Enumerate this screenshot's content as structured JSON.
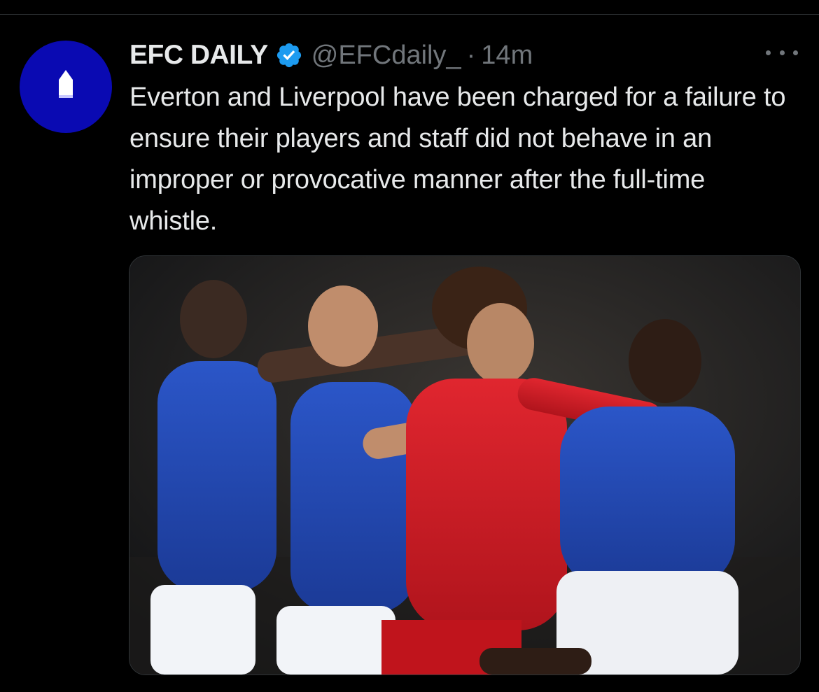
{
  "tweet": {
    "author": {
      "display_name": "EFC DAILY",
      "handle": "@EFCdaily_",
      "verified": true,
      "avatar_color": "#0a0ab2"
    },
    "separator": "·",
    "time": "14m",
    "text": "Everton and Liverpool have been charged for a failure to ensure their players and staff did not behave in an improper or provocative manner after the full-time whistle.",
    "media": {
      "kind": "photo"
    },
    "menu_icon": "more-horizontal-icon"
  },
  "colors": {
    "background": "#000000",
    "text_primary": "#e7e9ea",
    "text_secondary": "#71767b",
    "verified_blue": "#1d9bf0",
    "divider": "#2f3336"
  }
}
